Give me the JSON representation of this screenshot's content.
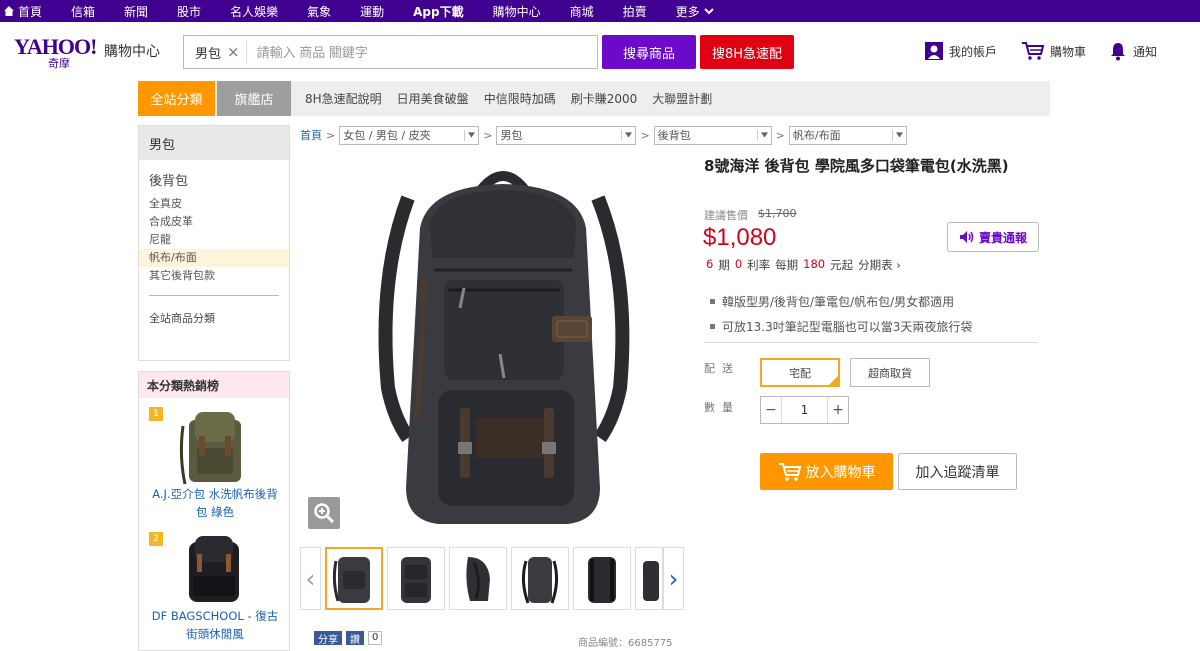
{
  "topnav": {
    "items": [
      "首頁",
      "信箱",
      "新聞",
      "股市",
      "名人娛樂",
      "氣象",
      "運動",
      "App下載",
      "購物中心",
      "商城",
      "拍賣",
      "更多"
    ]
  },
  "header": {
    "logo": "YAHOO!",
    "logo_sub": "奇摩",
    "site_title": "購物中心",
    "search_chip": "男包",
    "search_placeholder": "請輸入 商品 關鍵字",
    "search_button": "搜尋商品",
    "fast_button": "搜8H急速配",
    "account": "我的帳戶",
    "cart": "購物車",
    "notify": "通知"
  },
  "catbar": {
    "tab_all": "全站分類",
    "tab_flagship": "旗艦店",
    "links": [
      "8H急速配說明",
      "日用美食破盤",
      "中信限時加碼",
      "刷卡賺2000",
      "大聯盟計劃"
    ]
  },
  "sidebar": {
    "head": "男包",
    "sub": "後背包",
    "leaves": [
      "全真皮",
      "合成皮革",
      "尼龍",
      "帆布/布面",
      "其它後背包款"
    ],
    "active_index": 3,
    "all": "全站商品分類"
  },
  "hot": {
    "title": "本分類熱銷榜",
    "items": [
      {
        "rank": "1",
        "name": "A.J.亞介包 水洗帆布後背包 綠色"
      },
      {
        "rank": "2",
        "name": "DF BAGSCHOOL - 復古街頭休閒風"
      }
    ]
  },
  "breadcrumb": {
    "home": "首頁",
    "levels": [
      "女包 / 男包 / 皮夾",
      "男包",
      "後背包",
      "帆布/布面"
    ]
  },
  "product": {
    "title": "8號海洋 後背包 學院風多口袋筆電包(水洗黑)",
    "orig_label": "建議售價",
    "orig_price": "$1,700",
    "price": "$1,080",
    "installment": {
      "periods": "6",
      "periods_unit": "期",
      "rate": "0",
      "rate_label": "利率",
      "each": "每期",
      "amount": "180",
      "amount_label": "元起",
      "link": "分期表"
    },
    "notify_button": "賣貴通報",
    "features": [
      "韓版型男/後背包/筆電包/帆布包/男女都適用",
      "可放13.3吋筆記型電腦也可以當3天兩夜旅行袋"
    ],
    "ship_label": "配送",
    "ship_options": [
      "宅配",
      "超商取貨"
    ],
    "qty_label": "數量",
    "qty": "1",
    "add_cart": "放入購物車",
    "add_track": "加入追蹤清單",
    "share": "分享",
    "like": "讚",
    "like_count": "0",
    "pid": "商品編號：6685775"
  },
  "colors": {
    "brand": "#400090",
    "accent": "#ff9800",
    "price": "#d6001c",
    "search": "#6b0ac9"
  }
}
